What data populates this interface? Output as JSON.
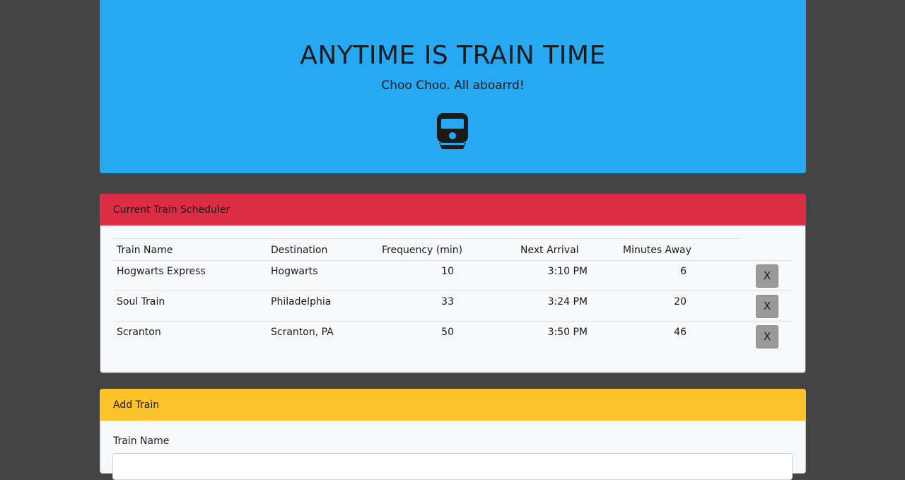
{
  "jumbotron": {
    "title": "ANYTIME IS TRAIN TIME",
    "subtitle": "Choo Choo. All aboarrd!",
    "icon": "train-icon"
  },
  "schedule": {
    "header": "Current Train Scheduler",
    "columns": {
      "name": "Train Name",
      "destination": "Destination",
      "frequency": "Frequency (min)",
      "next_arrival": "Next Arrival",
      "minutes_away": "Minutes Away"
    },
    "rows": [
      {
        "name": "Hogwarts Express",
        "destination": "Hogwarts",
        "frequency": "10",
        "next_arrival": "3:10 PM",
        "minutes_away": "6",
        "delete": "X"
      },
      {
        "name": "Soul Train",
        "destination": "Philadelphia",
        "frequency": "33",
        "next_arrival": "3:24 PM",
        "minutes_away": "20",
        "delete": "X"
      },
      {
        "name": "Scranton",
        "destination": "Scranton, PA",
        "frequency": "50",
        "next_arrival": "3:50 PM",
        "minutes_away": "46",
        "delete": "X"
      }
    ]
  },
  "add_train": {
    "header": "Add Train",
    "name_label": "Train Name",
    "name_value": ""
  },
  "colors": {
    "background": "#444444",
    "jumbotron": "#27a8f2",
    "schedule_accent": "#dc2d45",
    "add_accent": "#fcc22a"
  }
}
